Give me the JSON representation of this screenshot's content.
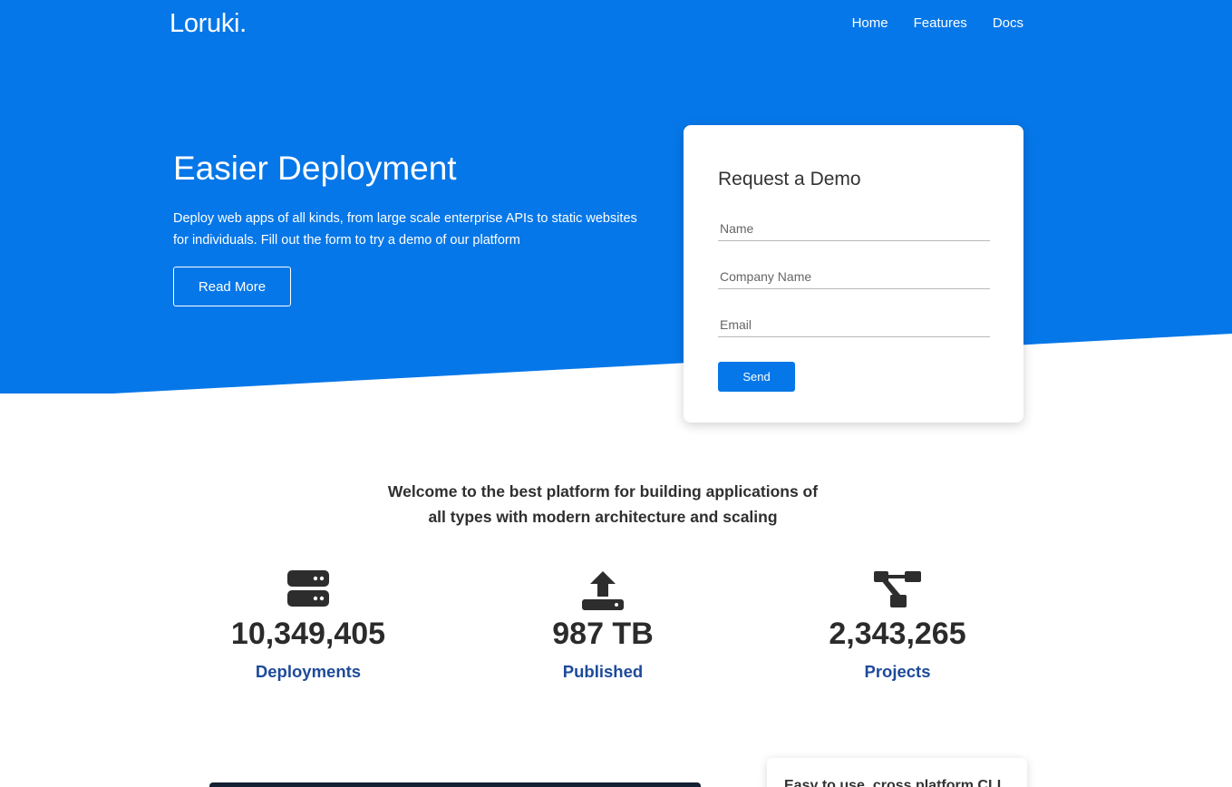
{
  "colors": {
    "brand": "#0677e8",
    "label": "#1e4a9a",
    "text": "#2b2b2b"
  },
  "nav": {
    "logo": "Loruki.",
    "links": [
      "Home",
      "Features",
      "Docs"
    ]
  },
  "hero": {
    "title": "Easier Deployment",
    "description": "Deploy web apps of all kinds, from large scale enterprise APIs to static websites for individuals. Fill out the form to try a demo of our platform",
    "button": "Read More"
  },
  "demo_form": {
    "title": "Request a Demo",
    "fields": [
      {
        "placeholder": "Name",
        "value": ""
      },
      {
        "placeholder": "Company Name",
        "value": ""
      },
      {
        "placeholder": "Email",
        "value": ""
      }
    ],
    "submit": "Send"
  },
  "welcome": "Welcome to the best platform for building applications of all types with modern architecture and scaling",
  "stats": [
    {
      "icon": "server-icon",
      "value": "10,349,405",
      "label": "Deployments"
    },
    {
      "icon": "upload-icon",
      "value": "987 TB",
      "label": "Published"
    },
    {
      "icon": "project-diagram-icon",
      "value": "2,343,265",
      "label": "Projects"
    }
  ],
  "bottom_card": {
    "text": "Easy to use, cross platform CLI"
  }
}
